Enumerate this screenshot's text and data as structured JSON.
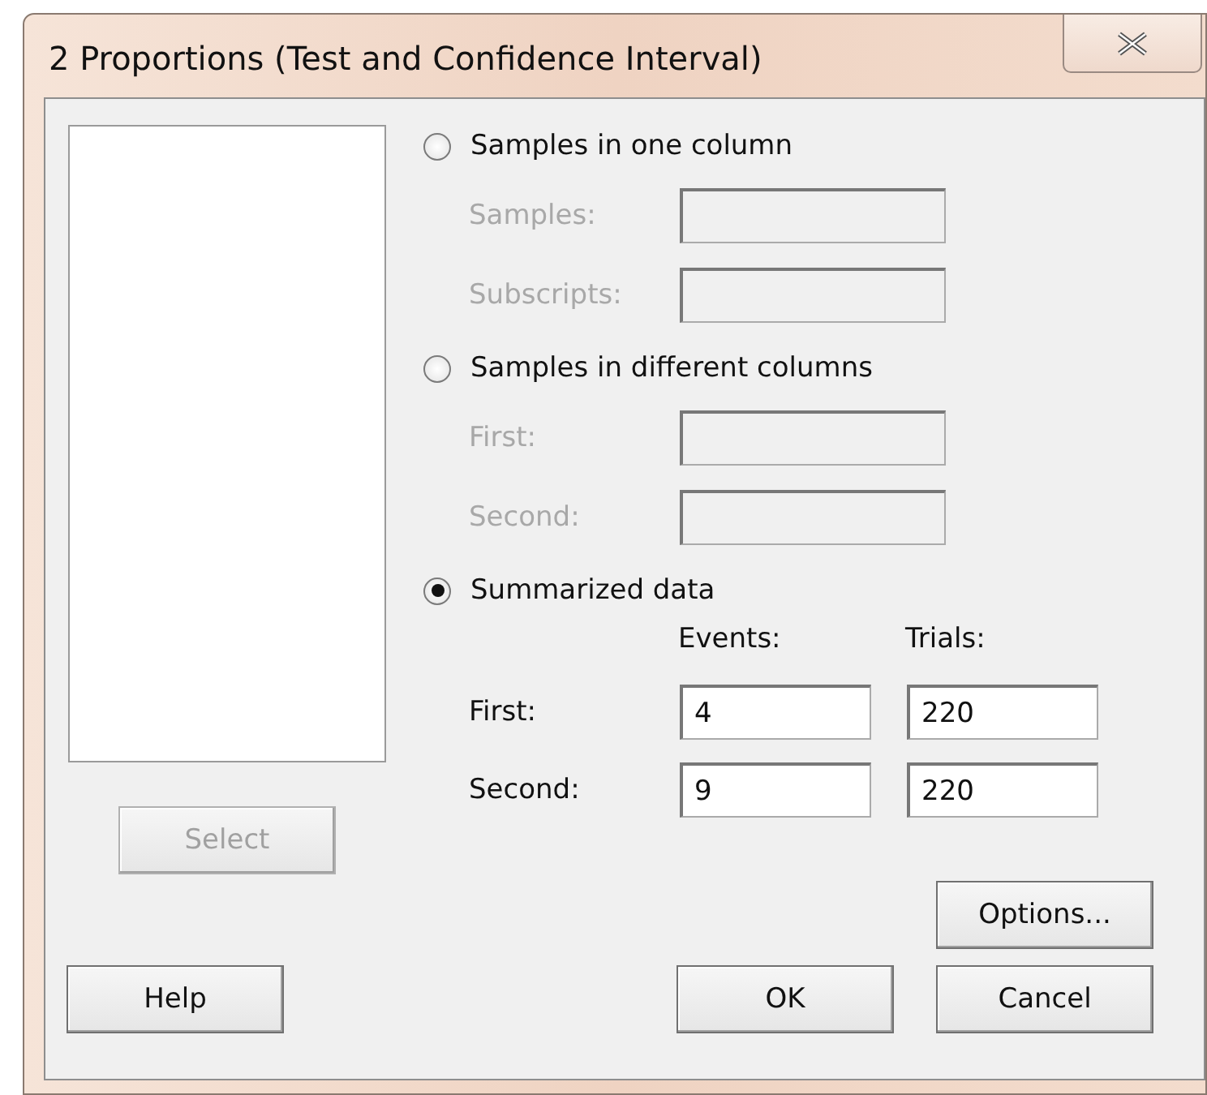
{
  "window": {
    "title": "2 Proportions (Test and Confidence Interval)"
  },
  "select_button": {
    "label": "Select",
    "disabled": true
  },
  "options": [
    {
      "kind": "columns",
      "label": "Samples in one column",
      "selected": false,
      "fields": [
        {
          "label": "Samples:",
          "disabled": true
        },
        {
          "label": "Subscripts:",
          "disabled": true
        }
      ]
    },
    {
      "kind": "columns",
      "label": "Samples in different columns",
      "selected": false,
      "fields": [
        {
          "label": "First:",
          "disabled": true
        },
        {
          "label": "Second:",
          "disabled": true
        }
      ]
    },
    {
      "kind": "summary",
      "label": "Summarized data",
      "selected": true,
      "columns": [
        "Events:",
        "Trials:"
      ],
      "rows": [
        {
          "label": "First:",
          "values": [
            "4",
            "220"
          ]
        },
        {
          "label": "Second:",
          "values": [
            "9",
            "220"
          ]
        }
      ]
    }
  ],
  "buttons": {
    "options": "Options...",
    "help": "Help",
    "ok": "OK",
    "cancel": "Cancel"
  }
}
